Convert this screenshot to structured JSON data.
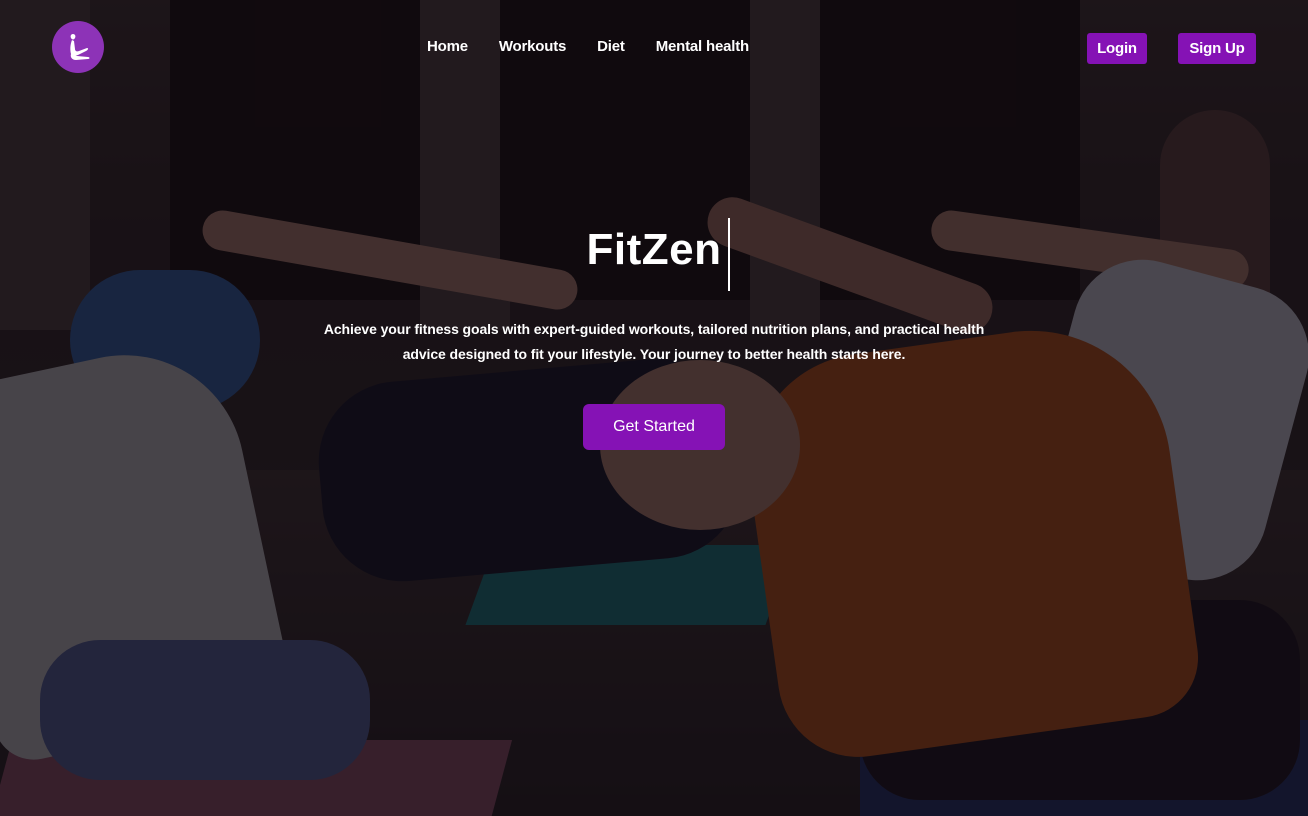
{
  "brand": {
    "name": "FitZen",
    "logo_icon": "yoga-pose-icon",
    "logo_color": "#8d33b7"
  },
  "nav": {
    "links": [
      {
        "label": "Home"
      },
      {
        "label": "Workouts"
      },
      {
        "label": "Diet"
      },
      {
        "label": "Mental health"
      }
    ],
    "login_label": "Login",
    "signup_label": "Sign Up"
  },
  "hero": {
    "title": "FitZen",
    "subtitle_line1": "Achieve your fitness goals with expert-guided workouts, tailored nutrition plans, and practical health",
    "subtitle_line2": "advice designed to fit your lifestyle. Your journey to better health starts here.",
    "cta_label": "Get Started"
  },
  "colors": {
    "accent": "#8512b5",
    "text": "#ffffff",
    "overlay": "rgba(10,6,14,0.70)"
  }
}
